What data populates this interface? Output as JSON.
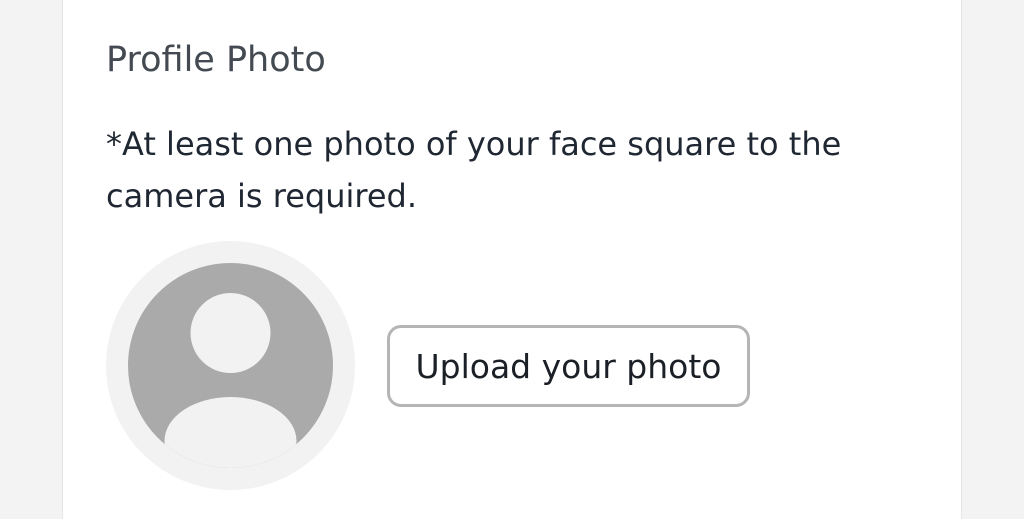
{
  "profile_photo": {
    "title": "Profile Photo",
    "requirement_note": "*At least one photo of your face square to the camera is required.",
    "upload_button_label": "Upload your photo",
    "avatar_icon": "user-silhouette-icon"
  },
  "colors": {
    "page_background": "#f3f3f3",
    "card_background": "#ffffff",
    "avatar_circle": "#aaaaaa",
    "avatar_ring": "#f2f2f2",
    "button_border": "#b5b5b5",
    "text_primary": "#1f2733",
    "title_text": "#444a52"
  }
}
